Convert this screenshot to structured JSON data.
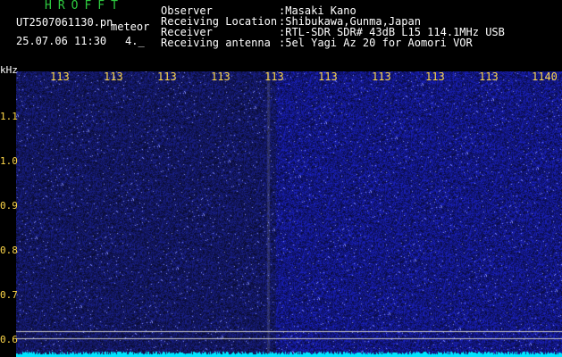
{
  "header": {
    "brand": "HROFFT",
    "file_name": "UT2507061130.pn",
    "file_tag": "meteor",
    "stamp": "25.07.06 11:30",
    "stamp_extra": "4._",
    "rows": [
      {
        "label": "Observer",
        "value": ":Masaki Kano"
      },
      {
        "label": "Receiving Location",
        "value": ":Shibukawa,Gunma,Japan"
      },
      {
        "label": "Receiver",
        "value": ":RTL-SDR SDR# 43dB L15 114.1MHz USB"
      },
      {
        "label": "Receiving antenna",
        "value": ":5el Yagi Az 20 for Aomori VOR"
      }
    ]
  },
  "axis": {
    "unit": "kHz",
    "x_ticks": [
      "113",
      "113",
      "113",
      "113",
      "113",
      "113",
      "113",
      "113",
      "113",
      "1140"
    ],
    "y_ticks": [
      "1.1",
      "1.0",
      "0.9",
      "0.8",
      "0.7",
      "0.6"
    ]
  },
  "colors": {
    "background": "#000000",
    "spectrum": "#1a1a8c",
    "signal_line": "#00e5ff",
    "brand": "#2ecc40",
    "tick_text": "#ffd84a"
  }
}
